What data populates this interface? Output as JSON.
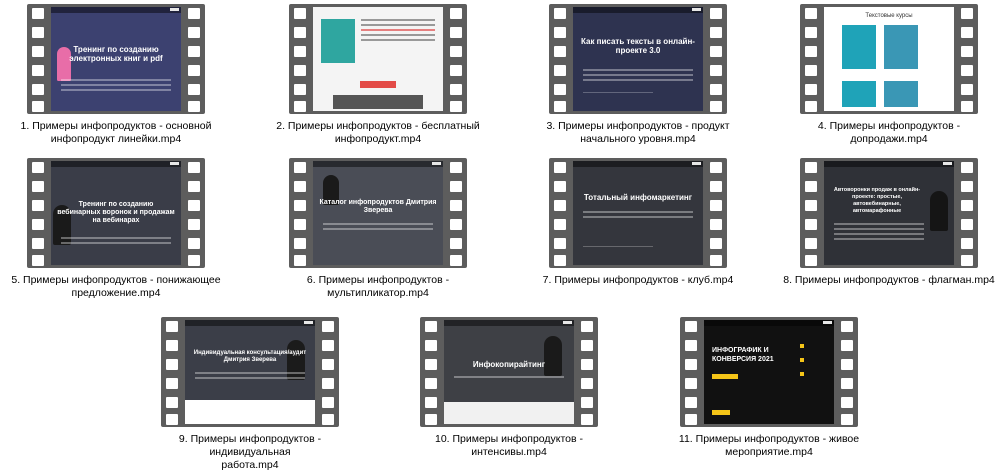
{
  "items": [
    {
      "line1": "1. Примеры инфопродуктов - основной",
      "line2": "инфопродукт линейки.mp4",
      "title": "Тренинг по созданию электронных книг и pdf"
    },
    {
      "line1": "2. Примеры инфопродуктов - бесплатный",
      "line2": "инфопродукт.mp4",
      "title": ""
    },
    {
      "line1": "3. Примеры инфопродуктов - продукт",
      "line2": "начального уровня.mp4",
      "title": "Как писать тексты в онлайн-проекте 3.0"
    },
    {
      "line1": "4. Примеры инфопродуктов - допродажи.mp4",
      "line2": "",
      "title": "Текстовые курсы"
    },
    {
      "line1": "5. Примеры инфопродуктов - понижающее",
      "line2": "предложение.mp4",
      "title": "Тренинг по созданию вебинарных воронок и продажам на вебинарах"
    },
    {
      "line1": "6. Примеры инфопродуктов -",
      "line2": "мультипликатор.mp4",
      "title": "Каталог инфопродуктов Дмитрия Зверева"
    },
    {
      "line1": "7. Примеры инфопродуктов - клуб.mp4",
      "line2": "",
      "title": "Тотальный инфомаркетинг"
    },
    {
      "line1": "8. Примеры инфопродуктов - флагман.mp4",
      "line2": "",
      "title": "Автоворонки продаж в онлайн-проекте: простые, автовебинарные, автомарафонные"
    },
    {
      "line1": "9. Примеры инфопродуктов - индивидуальная",
      "line2": "работа.mp4",
      "title": "Индивидуальная консультация/аудит Дмитрия Зверева"
    },
    {
      "line1": "10. Примеры инфопродуктов -",
      "line2": "интенсивы.mp4",
      "title": "Инфокопирайтинг"
    },
    {
      "line1": "11. Примеры инфопродуктов - живое",
      "line2": "мероприятие.mp4",
      "title": "ИНФОГРАФИК И КОНВЕРСИЯ 2021"
    }
  ],
  "colors": {
    "film": "#5d5d5d",
    "accent_red": "#e34b47",
    "accent_yellow": "#f5c518"
  }
}
